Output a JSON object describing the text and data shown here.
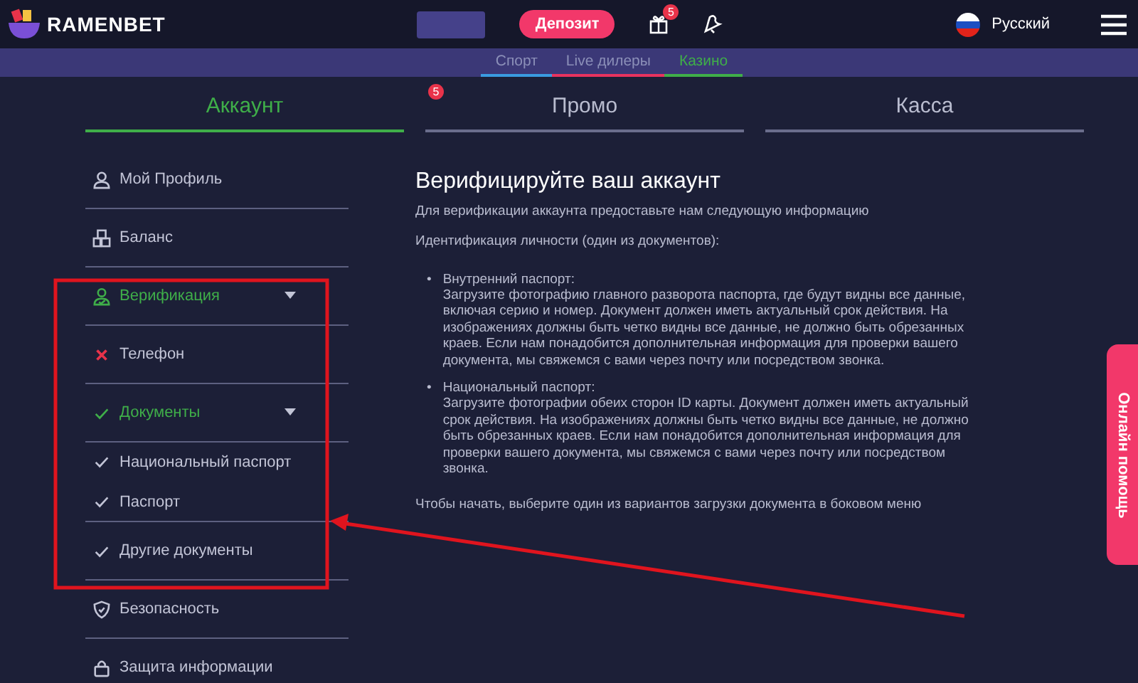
{
  "header": {
    "logo": "RAMENBET",
    "deposit_button": "Депозит",
    "gift_badge": "5",
    "language": "Русский"
  },
  "subnav": [
    {
      "label": "Спорт",
      "color": "#3a9be0",
      "selected": false
    },
    {
      "label": "Live дилеры",
      "color": "#e8335f",
      "selected": false
    },
    {
      "label": "Казино",
      "color": "#3fae49",
      "selected": true
    }
  ],
  "tabs": [
    {
      "label": "Аккаунт",
      "selected": true
    },
    {
      "label": "Промо",
      "selected": false,
      "badge": "5"
    },
    {
      "label": "Касса",
      "selected": false
    }
  ],
  "sidebar": {
    "items": [
      {
        "label": "Мой Профиль",
        "kind": "profile",
        "selected": false,
        "divider_below": true
      },
      {
        "label": "Баланс",
        "kind": "balance",
        "selected": false,
        "divider_below": true
      },
      {
        "label": "Верификация",
        "kind": "verify",
        "selected": true,
        "expanded": true,
        "divider_below": true,
        "children": [
          {
            "label": "Телефон",
            "kind": "failed",
            "selected": false,
            "divider_below": true
          },
          {
            "label": "Документы",
            "kind": "done",
            "selected": true,
            "expanded": true,
            "divider_below": true,
            "children": [
              {
                "label": "Национальный паспорт",
                "kind": "done",
                "selected": false,
                "divider_below": false
              },
              {
                "label": "Паспорт",
                "kind": "done",
                "selected": false,
                "divider_below": true
              },
              {
                "label": "Другие документы",
                "kind": "done",
                "selected": false,
                "divider_below": true
              }
            ]
          }
        ]
      },
      {
        "label": "Безопасность",
        "kind": "security",
        "selected": false,
        "divider_below": true
      },
      {
        "label": "Защита информации",
        "kind": "lock",
        "selected": false,
        "divider_below": false
      }
    ]
  },
  "content": {
    "title": "Верифицируйте ваш аккаунт",
    "intro": "Для верификации аккаунта предоставьте нам следующую информацию",
    "subtitle": "Идентификация личности (один из документов):",
    "documents": [
      {
        "marker": "•",
        "name": "Внутренний паспорт:",
        "text": "Загрузите фотографию главного разворота паспорта, где будут видны все данные, включая серию и номер. Документ должен иметь актуальный срок действия. На изображениях должны быть четко видны все данные, не должно быть обрезанных краев. Если нам понадобится дополнительная информация для проверки вашего документа, мы свяжемся с вами через почту или посредством звонка."
      },
      {
        "marker": "•",
        "name": "Национальный паспорт:",
        "text": "Загрузите фотографии обеих сторон ID карты. Документ должен иметь актуальный срок действия. На изображениях должны быть четко видны все данные, не должно быть обрезанных краев. Если нам понадобится дополнительная информация для проверки вашего документа, мы свяжемся с вами через почту или посредством звонка."
      }
    ],
    "footer": "Чтобы начать, выберите один из вариантов загрузки документа в боковом меню"
  },
  "help_button": "Онлайн помощь"
}
